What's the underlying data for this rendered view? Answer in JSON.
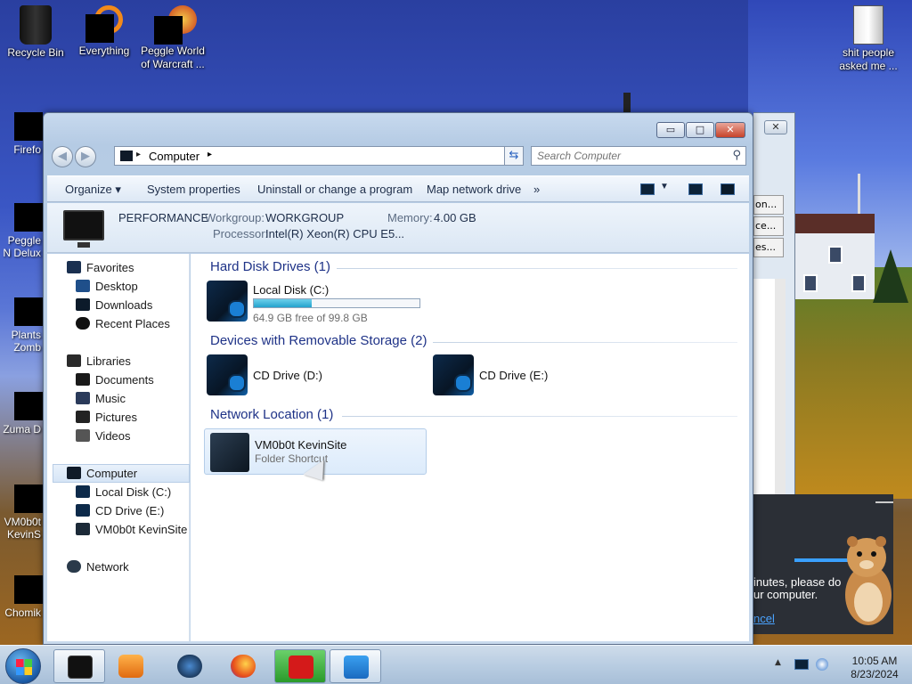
{
  "desktop": {
    "icons_top": [
      {
        "label": "Recycle Bin"
      },
      {
        "label": "Everything"
      },
      {
        "label": "Peggle World of Warcraft ..."
      },
      {
        "label": "shit people asked me ..."
      }
    ],
    "icons_left": [
      {
        "label": "Firefo"
      },
      {
        "label": "Peggle N Delux"
      },
      {
        "label": "Plants Zomb"
      },
      {
        "label": "Zuma D"
      },
      {
        "label": "VM0b0t KevinS"
      },
      {
        "label": "Chomik"
      }
    ]
  },
  "explorer": {
    "caption_buttons": {
      "minimize": "▭",
      "maximize": "□",
      "close": "✕"
    },
    "address": {
      "location": "Computer"
    },
    "search": {
      "placeholder": "Search Computer"
    },
    "commands": {
      "organize": "Organize",
      "system_properties": "System properties",
      "uninstall": "Uninstall or change a program",
      "map_drive": "Map network drive",
      "more": "»"
    },
    "details": {
      "name": "PERFORMANCE",
      "workgroup_label": "Workgroup:",
      "workgroup": "WORKGROUP",
      "memory_label": "Memory:",
      "memory": "4.00 GB",
      "processor_label": "Processor:",
      "processor": "Intel(R) Xeon(R) CPU E5..."
    },
    "nav": {
      "favorites": "Favorites",
      "desktop": "Desktop",
      "downloads": "Downloads",
      "recent": "Recent Places",
      "libraries": "Libraries",
      "documents": "Documents",
      "music": "Music",
      "pictures": "Pictures",
      "videos": "Videos",
      "computer": "Computer",
      "local_disk": "Local Disk (C:)",
      "cd_drive": "CD Drive (E:)",
      "kevinsite": "VM0b0t KevinSite",
      "network": "Network"
    },
    "groups": {
      "hdd": "Hard Disk Drives (1)",
      "removable": "Devices with Removable Storage (2)",
      "network": "Network Location (1)"
    },
    "drives": {
      "c_name": "Local Disk (C:)",
      "c_free": "64.9 GB free of 99.8 GB",
      "c_used_fraction": 0.35,
      "d_name": "CD Drive (D:)",
      "e_name": "CD Drive (E:)",
      "net_name": "VM0b0t KevinSite",
      "net_type": "Folder Shortcut"
    }
  },
  "bg_window": {
    "buttons": [
      "on...",
      "ce...",
      "es..."
    ],
    "close": "✕"
  },
  "toast": {
    "line1": "inutes, please do",
    "line2": "ur computer.",
    "cancel": "ncel"
  },
  "taskbar": {
    "time": "10:05 AM",
    "date": "8/23/2024",
    "tray_arrow": "▲"
  }
}
